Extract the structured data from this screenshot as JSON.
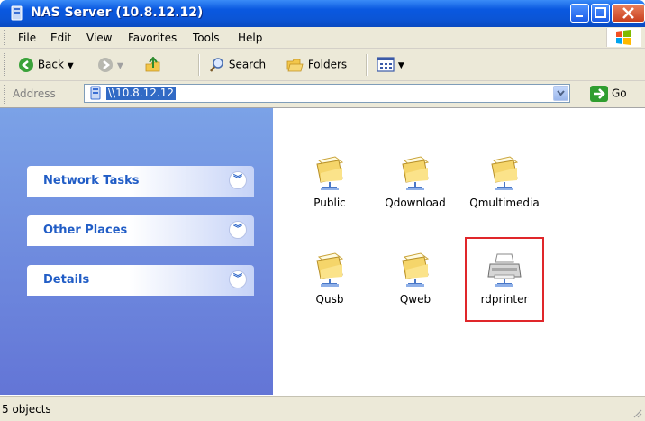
{
  "window": {
    "title": "NAS Server (10.8.12.12)",
    "icon": "network-drive-icon",
    "controls": [
      "minimize",
      "maximize",
      "close"
    ]
  },
  "menubar": {
    "items": [
      "File",
      "Edit",
      "View",
      "Favorites",
      "Tools",
      "Help"
    ]
  },
  "toolbar": {
    "back_label": "Back",
    "search_label": "Search",
    "folders_label": "Folders"
  },
  "address": {
    "label": "Address",
    "value": "\\\\10.8.12.12",
    "go_label": "Go"
  },
  "taskpane": {
    "sections": [
      "Network Tasks",
      "Other Places",
      "Details"
    ]
  },
  "files": [
    {
      "name": "Public",
      "type": "shared-folder-icon"
    },
    {
      "name": "Qdownload",
      "type": "shared-folder-icon"
    },
    {
      "name": "Qmultimedia",
      "type": "shared-folder-icon"
    },
    {
      "name": "Qusb",
      "type": "shared-folder-icon"
    },
    {
      "name": "Qweb",
      "type": "shared-folder-icon"
    },
    {
      "name": "rdprinter",
      "type": "network-printer-icon"
    }
  ],
  "status": {
    "text": "5 objects"
  },
  "colors": {
    "titlebar": "#0a58e0",
    "taskpane_top": "#7ba2e7",
    "taskpane_bottom": "#6375d6",
    "task_title": "#215dc6",
    "highlight": "#e0262a",
    "address_selection": "#316ac5"
  }
}
